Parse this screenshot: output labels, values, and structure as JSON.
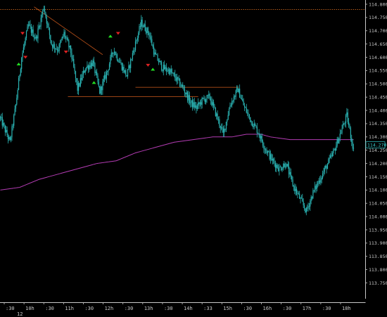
{
  "chart_data": {
    "type": "candlestick",
    "title": "",
    "instrument_display": "",
    "y_axis": {
      "position": "right",
      "min": 113.75,
      "max": 114.8,
      "ticks": [
        "114.800",
        "114.750",
        "114.700",
        "114.650",
        "114.600",
        "114.550",
        "114.500",
        "114.450",
        "114.400",
        "114.350",
        "114.300",
        "114.250",
        "114.200",
        "114.150",
        "114.100",
        "114.050",
        "114.000",
        "113.950",
        "113.900",
        "113.850",
        "113.800",
        "113.750"
      ]
    },
    "x_axis": {
      "tick_labels": [
        ":30",
        "10h",
        ":30",
        "11h",
        ":30",
        "12h",
        ":30",
        "13h",
        ":30",
        "14h",
        ":33",
        "15h",
        ":30",
        "16h",
        ":30",
        "17h",
        ":30",
        "18h"
      ],
      "date_label": "12"
    },
    "current_price": {
      "value": 114.27,
      "label": "114.270"
    },
    "candle_count": 300,
    "anchors": [
      {
        "i": 0,
        "p": 114.37
      },
      {
        "i": 10,
        "p": 114.28
      },
      {
        "i": 16,
        "p": 114.42
      },
      {
        "i": 22,
        "p": 114.6
      },
      {
        "i": 29,
        "p": 114.72
      },
      {
        "i": 37,
        "p": 114.67
      },
      {
        "i": 45,
        "p": 114.79
      },
      {
        "i": 53,
        "p": 114.65
      },
      {
        "i": 60,
        "p": 114.63
      },
      {
        "i": 66,
        "p": 114.69
      },
      {
        "i": 73,
        "p": 114.62
      },
      {
        "i": 80,
        "p": 114.48
      },
      {
        "i": 88,
        "p": 114.56
      },
      {
        "i": 96,
        "p": 114.58
      },
      {
        "i": 103,
        "p": 114.47
      },
      {
        "i": 111,
        "p": 114.55
      },
      {
        "i": 117,
        "p": 114.63
      },
      {
        "i": 124,
        "p": 114.58
      },
      {
        "i": 131,
        "p": 114.53
      },
      {
        "i": 139,
        "p": 114.64
      },
      {
        "i": 146,
        "p": 114.73
      },
      {
        "i": 154,
        "p": 114.69
      },
      {
        "i": 160,
        "p": 114.61
      },
      {
        "i": 168,
        "p": 114.56
      },
      {
        "i": 175,
        "p": 114.55
      },
      {
        "i": 182,
        "p": 114.52
      },
      {
        "i": 190,
        "p": 114.48
      },
      {
        "i": 197,
        "p": 114.43
      },
      {
        "i": 203,
        "p": 114.41
      },
      {
        "i": 210,
        "p": 114.44
      },
      {
        "i": 217,
        "p": 114.45
      },
      {
        "i": 224,
        "p": 114.38
      },
      {
        "i": 231,
        "p": 114.31
      },
      {
        "i": 238,
        "p": 114.42
      },
      {
        "i": 246,
        "p": 114.48
      },
      {
        "i": 253,
        "p": 114.41
      },
      {
        "i": 260,
        "p": 114.36
      },
      {
        "i": 267,
        "p": 114.32
      },
      {
        "i": 274,
        "p": 114.26
      },
      {
        "i": 282,
        "p": 114.21
      },
      {
        "i": 289,
        "p": 114.18
      },
      {
        "i": 296,
        "p": 114.2
      },
      {
        "i": 303,
        "p": 114.12
      },
      {
        "i": 310,
        "p": 114.07
      },
      {
        "i": 317,
        "p": 114.02
      },
      {
        "i": 324,
        "p": 114.09
      },
      {
        "i": 331,
        "p": 114.14
      },
      {
        "i": 338,
        "p": 114.19
      },
      {
        "i": 345,
        "p": 114.24
      },
      {
        "i": 352,
        "p": 114.31
      },
      {
        "i": 359,
        "p": 114.38
      },
      {
        "i": 366,
        "p": 114.25
      }
    ],
    "moving_average": {
      "points": [
        {
          "i": 0,
          "p": 114.1
        },
        {
          "i": 20,
          "p": 114.11
        },
        {
          "i": 40,
          "p": 114.14
        },
        {
          "i": 60,
          "p": 114.16
        },
        {
          "i": 80,
          "p": 114.18
        },
        {
          "i": 100,
          "p": 114.2
        },
        {
          "i": 120,
          "p": 114.21
        },
        {
          "i": 140,
          "p": 114.24
        },
        {
          "i": 160,
          "p": 114.26
        },
        {
          "i": 180,
          "p": 114.28
        },
        {
          "i": 200,
          "p": 114.29
        },
        {
          "i": 220,
          "p": 114.3
        },
        {
          "i": 240,
          "p": 114.3
        },
        {
          "i": 255,
          "p": 114.31
        },
        {
          "i": 270,
          "p": 114.31
        },
        {
          "i": 280,
          "p": 114.3
        },
        {
          "i": 300,
          "p": 114.29
        },
        {
          "i": 320,
          "p": 114.29
        },
        {
          "i": 340,
          "p": 114.29
        },
        {
          "i": 360,
          "p": 114.29
        },
        {
          "i": 366,
          "p": 114.29
        }
      ]
    },
    "trendlines": [
      {
        "from": {
          "i": 35,
          "p": 114.79
        },
        "to": {
          "i": 106,
          "p": 114.61
        }
      },
      {
        "from": {
          "i": 70,
          "p": 114.452
        },
        "to": {
          "i": 205,
          "p": 114.452
        }
      },
      {
        "from": {
          "i": 140,
          "p": 114.487
        },
        "to": {
          "i": 247,
          "p": 114.487
        }
      },
      {
        "from": {
          "i": 0,
          "p": 114.78
        },
        "to": {
          "i": 366,
          "p": 114.78
        }
      }
    ],
    "markers": [
      {
        "type": "sell",
        "i": 23,
        "p": 114.69
      },
      {
        "type": "sell",
        "i": 26,
        "p": 114.6
      },
      {
        "type": "buy",
        "i": 19,
        "p": 114.575
      },
      {
        "type": "sell",
        "i": 68,
        "p": 114.62
      },
      {
        "type": "buy",
        "i": 97,
        "p": 114.505
      },
      {
        "type": "buy",
        "i": 114,
        "p": 114.68
      },
      {
        "type": "sell",
        "i": 122,
        "p": 114.69
      },
      {
        "type": "sell",
        "i": 153,
        "p": 114.57
      },
      {
        "type": "buy",
        "i": 158,
        "p": 114.555
      }
    ],
    "colors": {
      "candle": "#2ab3b3",
      "background": "#000000",
      "moving_average": "#b43cb4",
      "trendline": "#b14d18",
      "dotted_line": "#c8641e",
      "buy_marker": "#22dd22",
      "sell_marker": "#e02222",
      "axis_text": "#c8c8c8"
    }
  }
}
